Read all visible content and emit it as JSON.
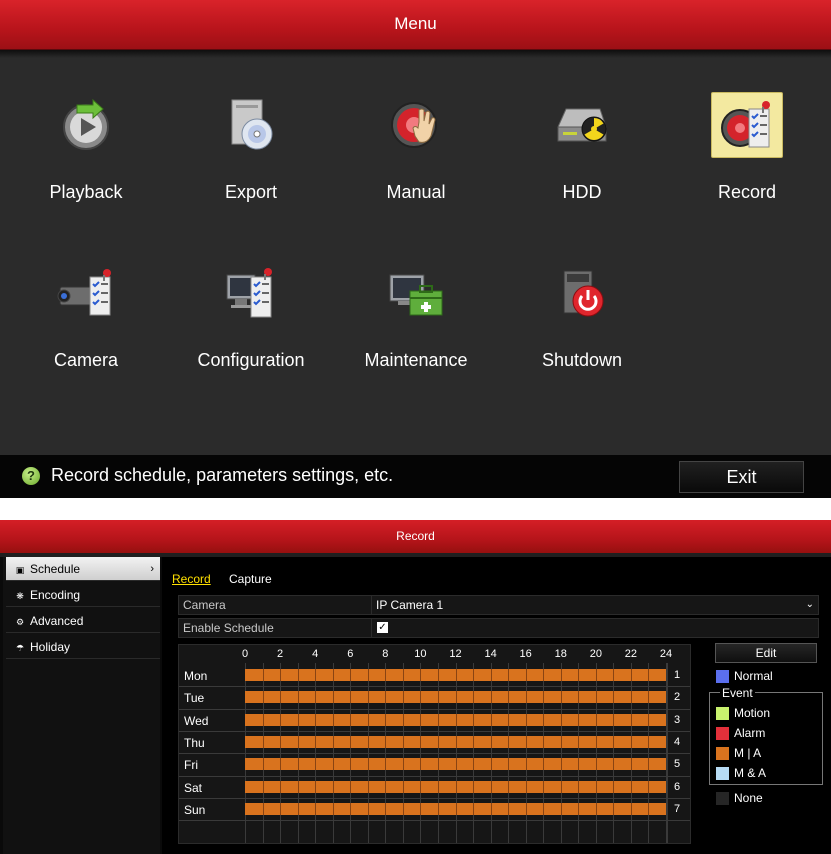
{
  "menu": {
    "title": "Menu",
    "tiles": [
      {
        "label": "Playback",
        "icon": "playback-icon"
      },
      {
        "label": "Export",
        "icon": "export-disc-icon"
      },
      {
        "label": "Manual",
        "icon": "manual-record-hand-icon"
      },
      {
        "label": "HDD",
        "icon": "hdd-icon"
      },
      {
        "label": "Record",
        "icon": "record-checklist-icon",
        "selected": true
      },
      {
        "label": "Camera",
        "icon": "camera-checklist-icon"
      },
      {
        "label": "Configuration",
        "icon": "configuration-monitor-icon"
      },
      {
        "label": "Maintenance",
        "icon": "maintenance-toolbox-icon"
      },
      {
        "label": "Shutdown",
        "icon": "shutdown-power-icon"
      }
    ],
    "help_text": "Record schedule, parameters settings, etc.",
    "exit_label": "Exit"
  },
  "record": {
    "title": "Record",
    "nav": [
      {
        "label": "Schedule",
        "icon": "schedule-icon",
        "active": true
      },
      {
        "label": "Encoding",
        "icon": "encoding-icon"
      },
      {
        "label": "Advanced",
        "icon": "advanced-icon"
      },
      {
        "label": "Holiday",
        "icon": "holiday-icon"
      }
    ],
    "tabs": [
      {
        "label": "Record",
        "active": true
      },
      {
        "label": "Capture"
      }
    ],
    "camera_label": "Camera",
    "camera_value": "IP Camera 1",
    "enable_schedule_label": "Enable Schedule",
    "enable_schedule_checked": true,
    "schedule": {
      "hour_labels": [
        "0",
        "2",
        "4",
        "6",
        "8",
        "10",
        "12",
        "14",
        "16",
        "18",
        "20",
        "22",
        "24"
      ],
      "days": [
        {
          "name": "Mon",
          "num": "1"
        },
        {
          "name": "Tue",
          "num": "2"
        },
        {
          "name": "Wed",
          "num": "3"
        },
        {
          "name": "Thu",
          "num": "4"
        },
        {
          "name": "Fri",
          "num": "5"
        },
        {
          "name": "Sat",
          "num": "6"
        },
        {
          "name": "Sun",
          "num": "7"
        }
      ],
      "fill_color": "#d9731e"
    },
    "edit_label": "Edit",
    "legend": {
      "normal": {
        "label": "Normal",
        "color": "#5b6fee"
      },
      "event_title": "Event",
      "motion": {
        "label": "Motion",
        "color": "#c9f26e"
      },
      "alarm": {
        "label": "Alarm",
        "color": "#e3303a"
      },
      "m_or_a": {
        "label": "M | A",
        "color": "#d9731e"
      },
      "m_and_a": {
        "label": "M & A",
        "color": "#b7dcf5"
      },
      "none": {
        "label": "None",
        "color": "#262626"
      }
    }
  }
}
